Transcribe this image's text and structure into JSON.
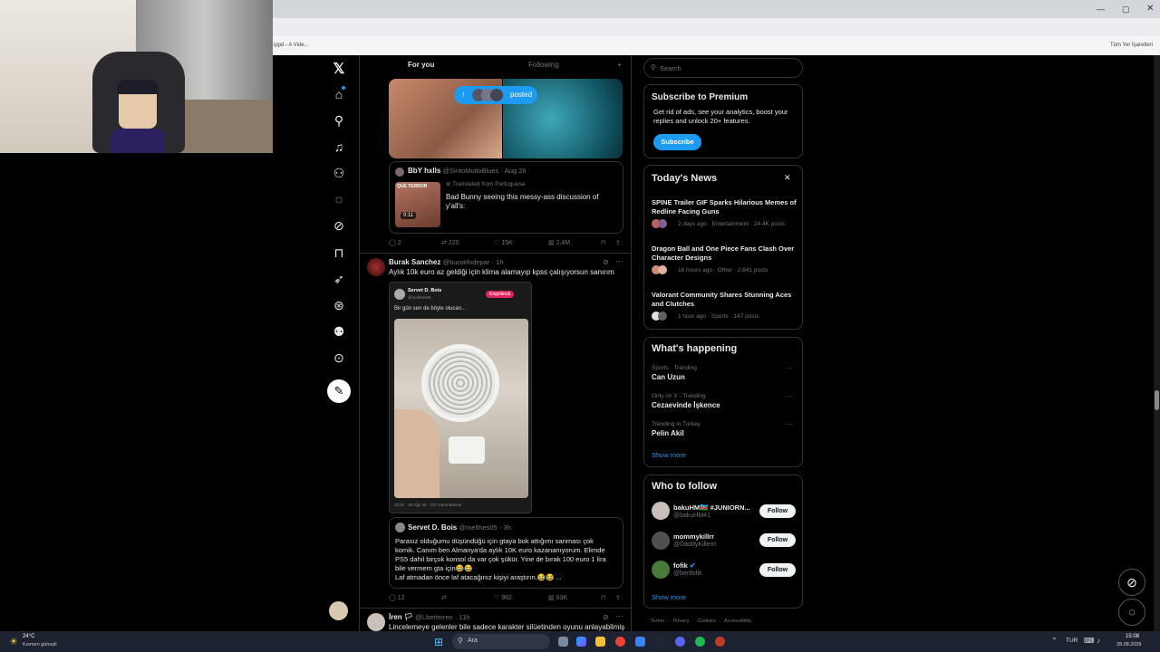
{
  "browser": {
    "bookmark_left": "ippd - A Vide...",
    "bookmark_right": "Tüm Yer İşaretleri"
  },
  "nav": {
    "home": "Home",
    "explore": "Explore",
    "notifications": "Notifications",
    "follow": "Follow",
    "messages": "Messages",
    "grok": "Grok",
    "bookmarks": "Bookmarks",
    "jobs": "Jobs",
    "verified": "Verified",
    "profile": "Profile",
    "more": "More",
    "post": "Post"
  },
  "timeline": {
    "tabs": [
      "For you",
      "Following"
    ],
    "new_posts_pill": "posted",
    "quote1": {
      "name": "BbY hxlls",
      "handle": "@SintoMuitoBlues",
      "date": "· Aug 26",
      "translated": "Translated from Portuguese",
      "video_duration": "0:11",
      "video_caption": "QUE TERROR",
      "text": "Bad Bunny seeing this messy-ass discussion of y'all's:"
    },
    "tweet1_actions": {
      "replies": "2",
      "reposts": "220",
      "likes": "15K",
      "views": "2.4M"
    },
    "tweet2": {
      "name": "Burak Sanchez",
      "handle": "@burakfodepar",
      "time": "· 1h",
      "text": "Aylık 10k euro az geldiği için klima alamayıp kpss çalışıyorsun sanırım",
      "embed_name": "Servet D. Bois",
      "embed_handle": "@melthes05",
      "embed_badge": "Engellendi",
      "embed_text": "Bir gün sen de böyle olucan...",
      "embed_footer": "22:01 · 05 Ağu 26 · 137 Görüntüleme"
    },
    "quote2": {
      "name": "Servet D. Bois",
      "handle": "@melthes05",
      "time": "· 3h",
      "lines": [
        "Parasız olduğumu düşündüğü için gtaya bok attığımı sanması çok",
        "komik. Canım ben Almanya'da aylık 10K euro kazananıyorum. Elimde",
        "PS5 dahil birçok konsol da var çok şükür. Yine de bırak 100 euro 1 lira",
        "bile vermem gta için😂😂",
        "Laf atmadan önce laf atacağınız kişiyi araştırın.😂😂 ..."
      ]
    },
    "tweet2_actions": {
      "replies": "12",
      "reposts": "",
      "likes": "982",
      "views": "63K"
    },
    "tweet3": {
      "name": "İren 🏳",
      "handle": "@Lberteiren",
      "time": "· 11h",
      "text": "Lincelemeye gelenler bile sadece karakter silüetinden oyunu anlayabilmiş"
    }
  },
  "sidebar": {
    "search_placeholder": "Search",
    "premium": {
      "title": "Subscribe to Premium",
      "body1": "Get rid of ads, see your analytics, boost your",
      "body2": "replies and unlock 20+ features.",
      "button": "Subscribe"
    },
    "news": {
      "title": "Today's News",
      "items": [
        {
          "title": "SPINE Trailer GIF Sparks Hilarious Memes of Redline Facing Guns",
          "meta": "2 days ago · Entertainment · 24.4K posts"
        },
        {
          "title": "Dragon Ball and One Piece Fans Clash Over Character Designs",
          "meta": "16 hours ago · Other · 2,641 posts"
        },
        {
          "title": "Valorant Community Shares Stunning Aces and Clutches",
          "meta": "1 hour ago · Sports · 147 posts"
        }
      ]
    },
    "happening": {
      "title": "What's happening",
      "items": [
        {
          "context": "Sports · Trending",
          "name": "Can Uzun"
        },
        {
          "context": "Only on X · Trending",
          "name": "Cezaevinde İşkence"
        },
        {
          "context": "Trending in Turkey",
          "name": "Pelin Akil"
        }
      ],
      "show_more": "Show more"
    },
    "who_to_follow": {
      "title": "Who to follow",
      "items": [
        {
          "name": "bakuHM🇦🇿 #JUNIORN...",
          "handle": "@bakuHM41",
          "button": "Follow"
        },
        {
          "name": "mommykillrr",
          "handle": "@DaddyKillerrr",
          "button": "Follow"
        },
        {
          "name": "fofik",
          "handle": "@benfofik",
          "button": "Follow"
        }
      ],
      "show_more": "Show more"
    },
    "footer": [
      "Terms",
      "Privacy",
      "Cookies",
      "Accessibility"
    ]
  },
  "taskbar": {
    "weather_temp": "24°C",
    "weather_desc": "Kısmen güneşli",
    "search": "Ara",
    "lang": "TUR",
    "time": "15:08",
    "date": "28.08.2026"
  },
  "colors": {
    "accent": "#1d9bf0",
    "background": "#000000",
    "border": "#2f3336",
    "muted": "#71767b"
  }
}
